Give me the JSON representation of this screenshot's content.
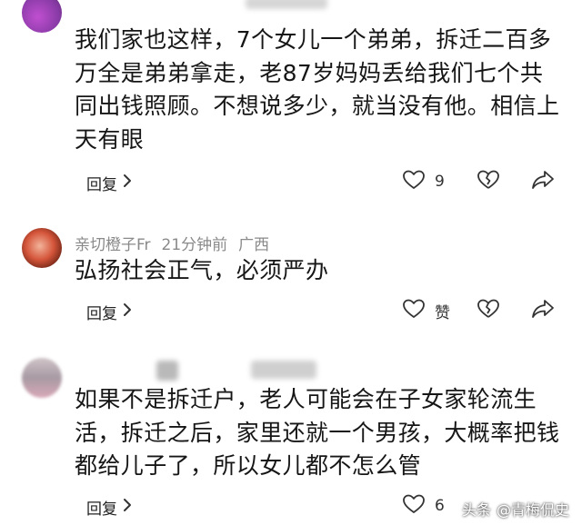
{
  "comments": [
    {
      "text": "我们家也这样，7个女儿一个弟弟，拆迁二百多万全是弟弟拿走，老87岁妈妈丢给我们七个共同出钱照顾。不想说多少，就当没有他。相信上天有眼",
      "reply_label": "回复",
      "like_count": "9"
    },
    {
      "username": "亲切橙子Fr",
      "time": "21分钟前",
      "location": "广西",
      "text": "弘扬社会正气，必须严办",
      "reply_label": "回复",
      "like_count": "赞"
    },
    {
      "text": "如果不是拆迁户，老人可能会在子女家轮流生活，拆迁之后，家里还就一个男孩，大概率把钱都给儿子了，所以女儿都不怎么管",
      "reply_label": "回复",
      "like_count": "6"
    }
  ],
  "watermark": {
    "prefix": "头条",
    "account": "@青梅侃史"
  },
  "colors": {
    "text": "#161616",
    "meta": "#8a8a8a",
    "icon": "#333333"
  }
}
